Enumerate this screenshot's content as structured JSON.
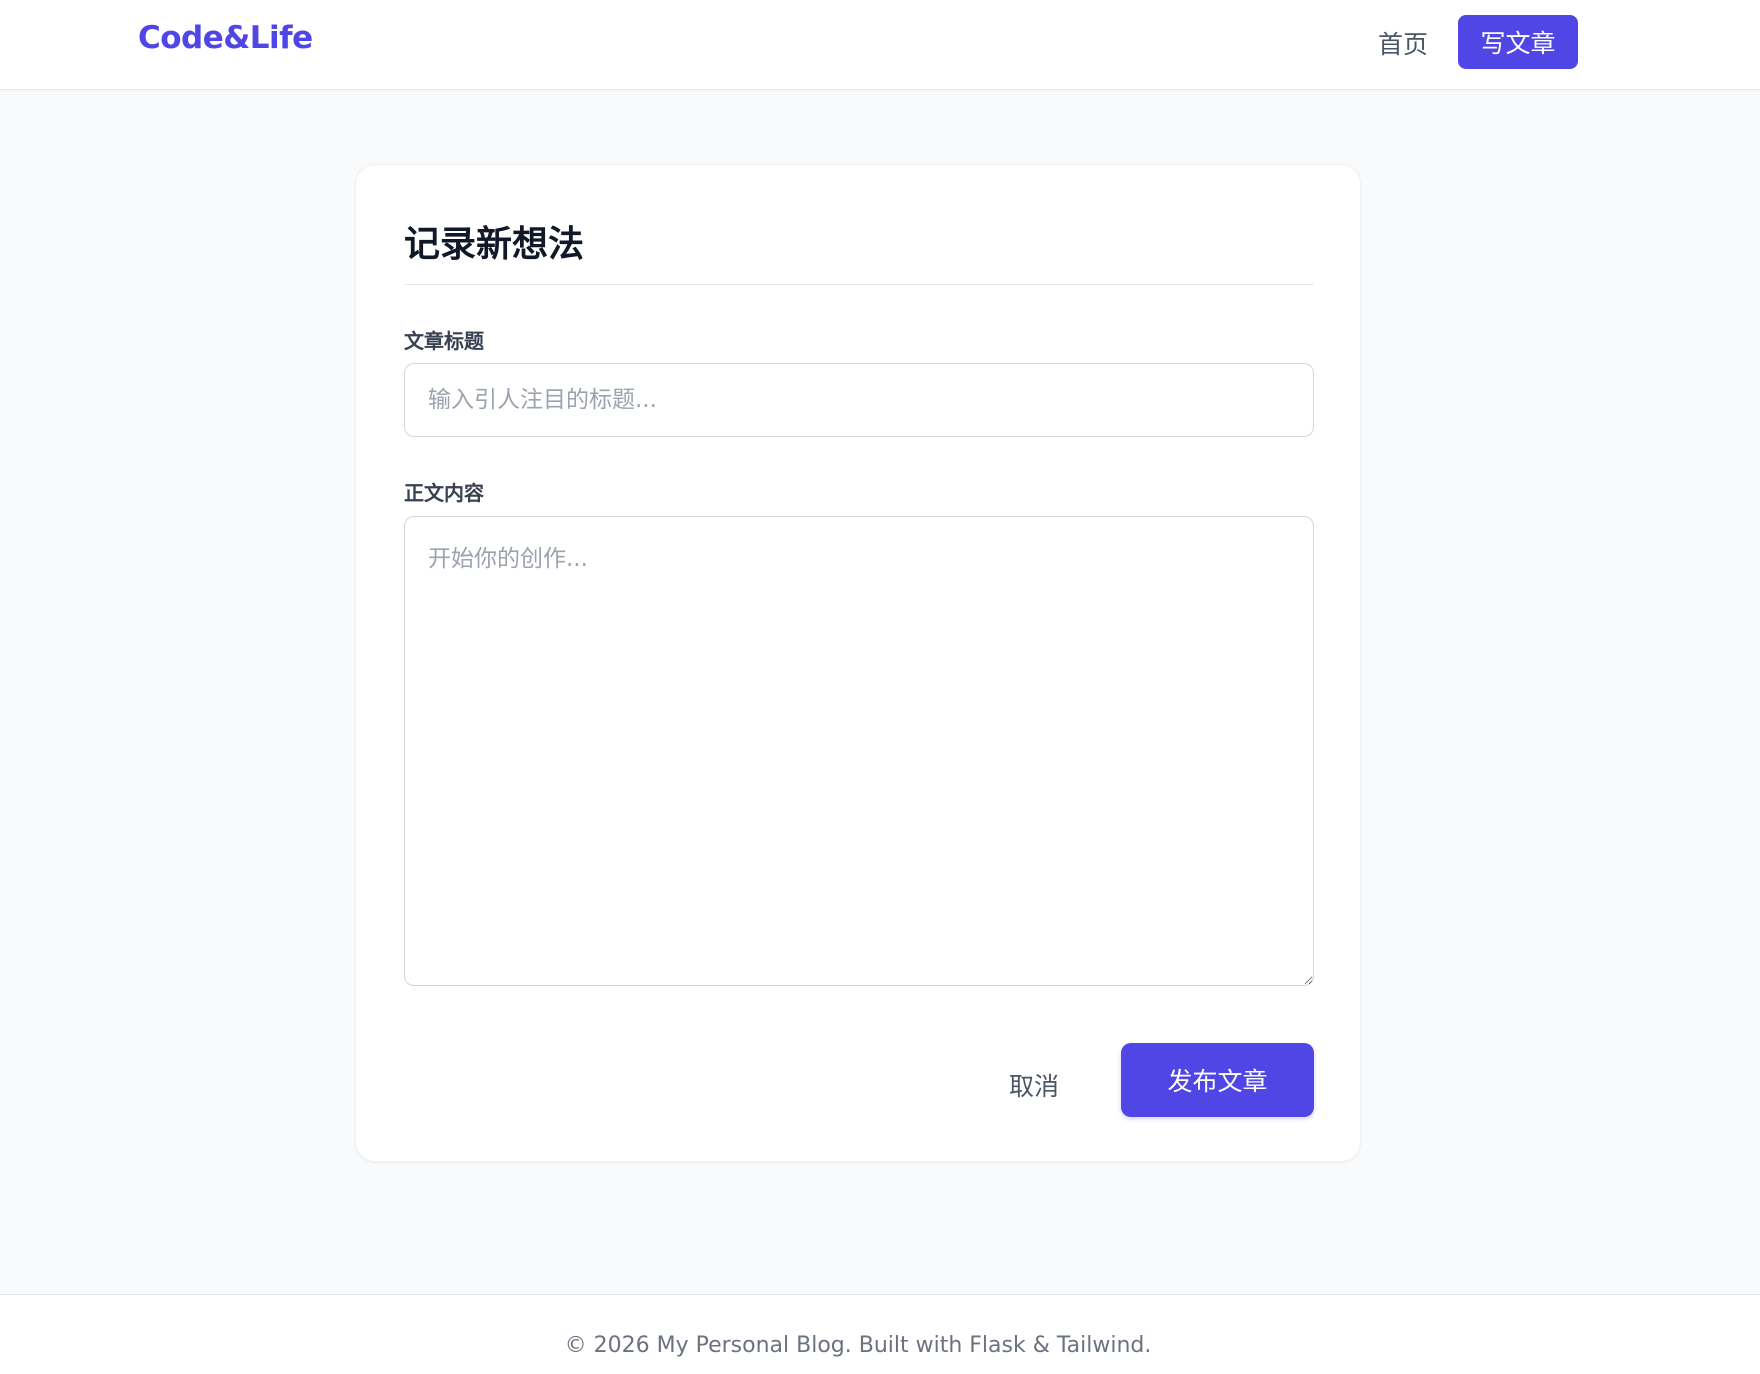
{
  "navbar": {
    "brand": "Code&Life",
    "home_label": "首页",
    "write_label": "写文章"
  },
  "form": {
    "heading": "记录新想法",
    "title_label": "文章标题",
    "title_placeholder": "输入引人注目的标题...",
    "title_value": "",
    "content_label": "正文内容",
    "content_placeholder": "开始你的创作...",
    "content_value": "",
    "cancel_label": "取消",
    "publish_label": "发布文章"
  },
  "footer": {
    "text": "© 2026 My Personal Blog. Built with Flask & Tailwind."
  },
  "colors": {
    "accent": "#4f46e5",
    "background": "#f9fafb",
    "card": "#ffffff",
    "muted_text": "#6b7280"
  }
}
